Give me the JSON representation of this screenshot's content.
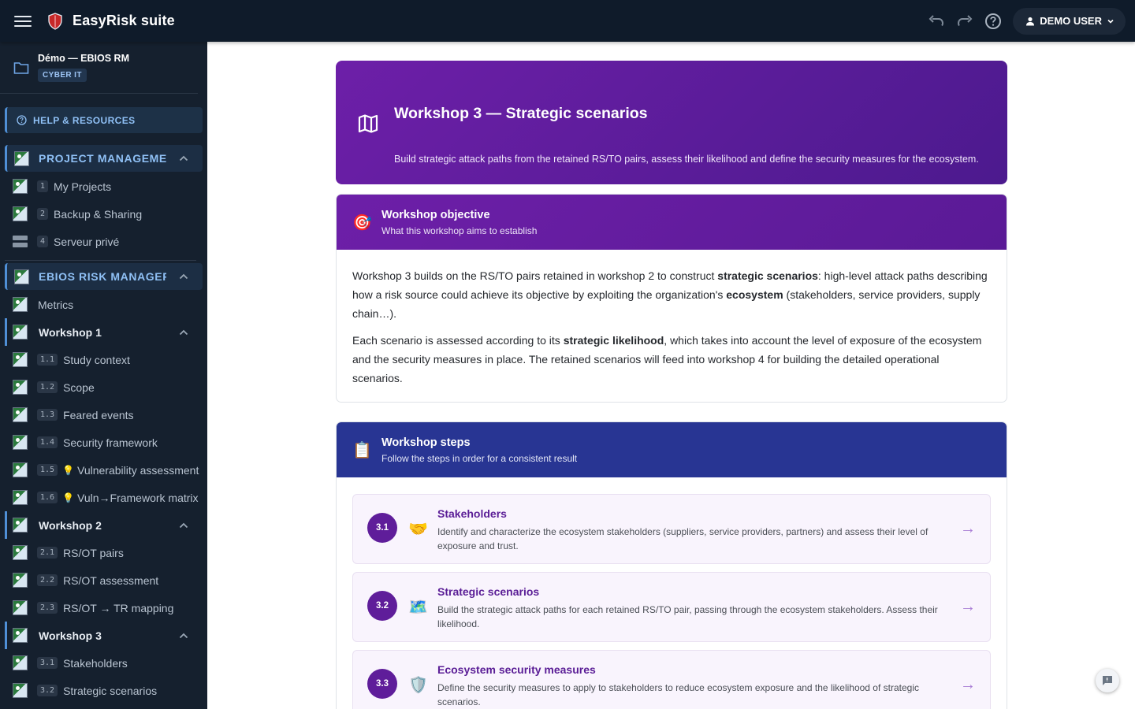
{
  "app": {
    "title": "EasyRisk suite"
  },
  "user": {
    "name": "DEMO USER"
  },
  "project": {
    "name": "Démo — EBIOS RM",
    "tag": "CYBER IT"
  },
  "sidebar": {
    "help_label": "HELP & RESOURCES",
    "project_section": {
      "label": "PROJECT MANAGEMEN",
      "items": [
        {
          "num": "1",
          "label": "My Projects"
        },
        {
          "num": "2",
          "label": "Backup & Sharing"
        },
        {
          "num": "4",
          "label": "Serveur privé"
        }
      ]
    },
    "ebios_section": {
      "label": "EBIOS RISK MANAGER",
      "metrics_label": "Metrics",
      "workshop1": {
        "label": "Workshop 1",
        "items": [
          {
            "num": "1.1",
            "label": "Study context"
          },
          {
            "num": "1.2",
            "label": "Scope"
          },
          {
            "num": "1.3",
            "label": "Feared events"
          },
          {
            "num": "1.4",
            "label": "Security framework"
          },
          {
            "num": "1.5",
            "label": "Vulnerability assessment"
          },
          {
            "num": "1.6",
            "label": "Vuln→Framework matrix"
          }
        ]
      },
      "workshop2": {
        "label": "Workshop 2",
        "items": [
          {
            "num": "2.1",
            "label": "RS/OT pairs"
          },
          {
            "num": "2.2",
            "label": "RS/OT assessment"
          },
          {
            "num": "2.3",
            "label": "RS/OT → TR mapping"
          }
        ]
      },
      "workshop3": {
        "label": "Workshop 3",
        "items": [
          {
            "num": "3.1",
            "label": "Stakeholders"
          },
          {
            "num": "3.2",
            "label": "Strategic scenarios"
          }
        ]
      }
    }
  },
  "hero": {
    "title": "Workshop 3 — Strategic scenarios",
    "subtitle": "Build strategic attack paths from the retained RS/TO pairs, assess their likelihood and define the security measures for the ecosystem."
  },
  "objective": {
    "title": "Workshop objective",
    "subtitle": "What this workshop aims to establish",
    "p1": {
      "a": "Workshop 3 builds on the RS/TO pairs retained in workshop 2 to construct ",
      "b": "strategic scenarios",
      "c": ": high-level attack paths describing how a risk source could achieve its objective by exploiting the organization's ",
      "d": "ecosystem",
      "e": " (stakeholders, service providers, supply chain…)."
    },
    "p2": {
      "a": "Each scenario is assessed according to its ",
      "b": "strategic likelihood",
      "c": ", which takes into account the level of exposure of the ecosystem and the security measures in place. The retained scenarios will feed into workshop 4 for building the detailed operational scenarios."
    }
  },
  "steps": {
    "title": "Workshop steps",
    "subtitle": "Follow the steps in order for a consistent result",
    "items": [
      {
        "num": "3.1",
        "icon": "🤝",
        "title": "Stakeholders",
        "desc": "Identify and characterize the ecosystem stakeholders (suppliers, service providers, partners) and assess their level of exposure and trust."
      },
      {
        "num": "3.2",
        "icon": "🗺️",
        "title": "Strategic scenarios",
        "desc": "Build the strategic attack paths for each retained RS/TO pair, passing through the ecosystem stakeholders. Assess their likelihood."
      },
      {
        "num": "3.3",
        "icon": "🛡️",
        "title": "Ecosystem security measures",
        "desc": "Define the security measures to apply to stakeholders to reduce ecosystem exposure and the likelihood of strategic scenarios."
      }
    ]
  },
  "icons": {
    "objective": "🎯",
    "steps": "📋",
    "bulb": "💡"
  },
  "colors": {
    "topbar": "#0f1b2a",
    "sidebar": "#15202e",
    "accent_purple": "#5f1d9a",
    "steps_header": "#283593",
    "sidebar_accent": "#4f8fd6"
  }
}
